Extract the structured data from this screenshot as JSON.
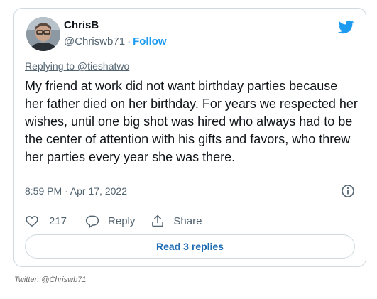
{
  "author": {
    "name": "ChrisB",
    "handle": "@Chriswb71",
    "separator": "·",
    "follow_label": "Follow"
  },
  "reply_context": "Replying to @tieshatwo",
  "tweet_text": "My friend at work did not want birthday parties because her father died on her birthday. For years we respected her wishes, until one big shot was hired who always had to be the center of attention with his gifts and favors, who threw her parties every year she was there.",
  "timestamp": "8:59 PM · Apr 17, 2022",
  "actions": {
    "like_count": "217",
    "reply_label": "Reply",
    "share_label": "Share"
  },
  "read_replies_label": "Read 3 replies",
  "credit": "Twitter: @Chriswb71",
  "colors": {
    "brand_blue": "#1d9bf0",
    "text_primary": "#0f1419",
    "text_secondary": "#536471",
    "border": "#cfd9de"
  },
  "icons": [
    "twitter-bird-icon",
    "info-icon",
    "heart-icon",
    "reply-icon",
    "share-icon"
  ]
}
